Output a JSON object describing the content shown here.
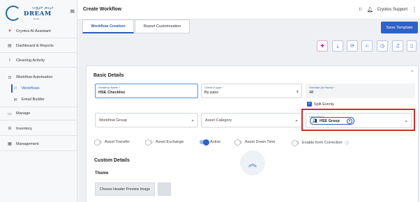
{
  "app": {
    "logo_arabic": "دريـم جروب",
    "logo_dream": "DREAM",
    "logo_sub": "Group"
  },
  "sidebar": {
    "items": [
      {
        "label": "Cryotos AI Assistant",
        "icon": "sparkle-icon"
      },
      {
        "label": "Dashboard & Reports",
        "icon": "dashboard-icon"
      },
      {
        "label": "Cleaning Activity",
        "icon": "broom-icon"
      },
      {
        "label": "Workflow Automation",
        "icon": "workflow-icon"
      },
      {
        "label": "Manage",
        "icon": "manage-icon"
      },
      {
        "label": "Inventory",
        "icon": "inventory-icon"
      },
      {
        "label": "Management",
        "icon": "management-icon"
      }
    ],
    "sub_items": [
      {
        "label": "Workflows",
        "icon": "workflow-tree-icon",
        "active": true
      },
      {
        "label": "Email Builder",
        "icon": "email-icon",
        "active": false
      }
    ]
  },
  "header": {
    "title": "Create Workflow",
    "user": "Cryotos Support"
  },
  "tabs": [
    {
      "label": "Workflow Creation",
      "active": true
    },
    {
      "label": "Report Customization",
      "active": false
    }
  ],
  "save_button": "Save Template",
  "toolbar_icons": [
    "add-icon",
    "download-icon",
    "refresh-doc-icon",
    "flow-icon",
    "timer-icon",
    "bell-icon",
    "mobile-icon",
    "history-icon"
  ],
  "basic_details": {
    "title": "Basic Details",
    "workflow_name": {
      "label": "Workflow Name",
      "value": "HSE Checklist"
    },
    "check_in_type": {
      "label": "Check in type",
      "value": "By pass"
    },
    "overdue_hours": {
      "label": "Overdue (in Hours)",
      "value": "48"
    },
    "split_evenly": {
      "label": "Split Evenly",
      "checked": true
    },
    "workflow_group": {
      "placeholder": "Workflow Group"
    },
    "asset_category": {
      "placeholder": "Asset Category"
    },
    "user_group": {
      "label": "User Group",
      "chip": "HSE Group"
    }
  },
  "toggles": [
    {
      "label": "Asset Transfer",
      "on": false
    },
    {
      "label": "Asset Exchange",
      "on": false
    },
    {
      "label": "Active",
      "on": true
    },
    {
      "label": "Asset Down Time",
      "on": false
    },
    {
      "label": "Enable form Correction",
      "on": false
    }
  ],
  "custom_details": {
    "title": "Custom Details",
    "theme_label": "Theme",
    "preview_button": "Choose Header Preview Image"
  },
  "colors": {
    "primary": "#2f62c4",
    "highlight": "#d42a2a"
  }
}
